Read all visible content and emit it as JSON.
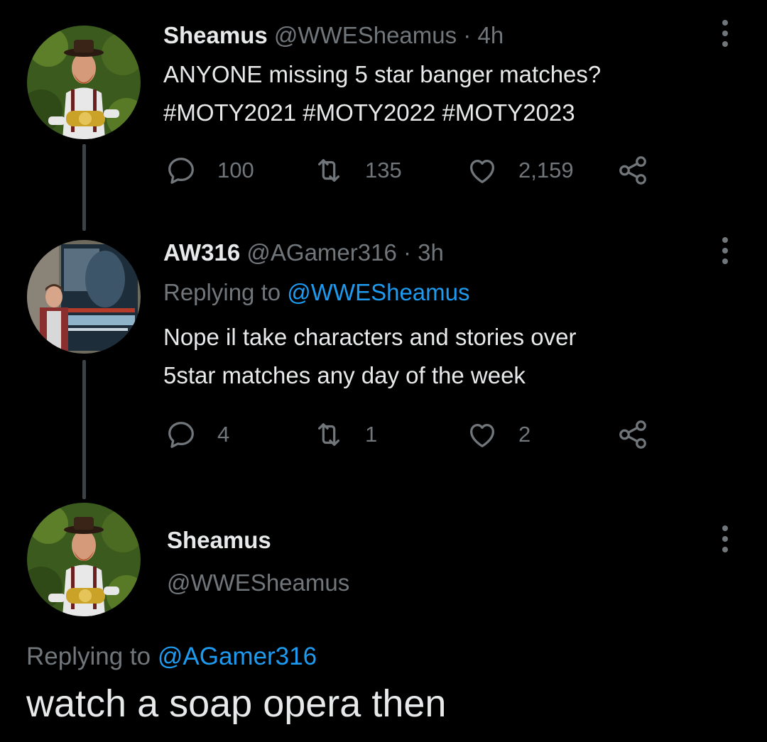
{
  "tweet1": {
    "author_name": "Sheamus",
    "author_handle": "@WWESheamus",
    "separator": "·",
    "time": "4h",
    "text": "ANYONE missing 5 star banger matches?",
    "hashtags": "#MOTY2021 #MOTY2022 #MOTY2023",
    "replies": "100",
    "retweets": "135",
    "likes": "2,159",
    "avatar_icon": "profile-photo-man-with-hat-and-belt"
  },
  "tweet2": {
    "author_name": "AW316",
    "author_handle": "@AGamer316",
    "separator": "·",
    "time": "3h",
    "replying_label": "Replying to",
    "replying_handle": "@WWESheamus",
    "text_line1": "Nope il take characters and stories over",
    "text_line2": "5star matches any day of the week",
    "replies": "4",
    "retweets": "1",
    "likes": "2",
    "avatar_icon": "profile-photo-man-in-front-of-poster"
  },
  "main_tweet": {
    "author_name": "Sheamus",
    "author_handle": "@WWESheamus",
    "replying_label": "Replying to",
    "replying_handle": "@AGamer316",
    "text": "watch a soap opera then",
    "avatar_icon": "profile-photo-man-with-hat-and-belt"
  },
  "colors": {
    "background": "#000000",
    "text": "#e7e9ea",
    "muted": "#71767b",
    "link": "#1d9bf0",
    "thread_line": "#3d4246"
  }
}
